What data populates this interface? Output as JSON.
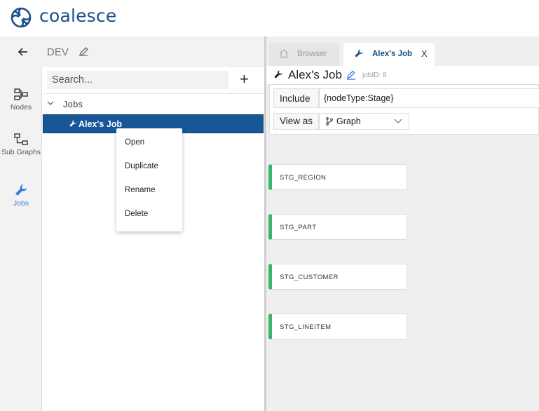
{
  "app": {
    "name": "coalesce",
    "brand_color": "#1a4f8b"
  },
  "subbar": {
    "back_icon": "arrow-left-icon",
    "env": "DEV",
    "edit_icon": "pencil-icon"
  },
  "rail": [
    {
      "label": "Nodes",
      "icon": "nodes-icon"
    },
    {
      "label": "Sub Graphs",
      "icon": "subgraphs-icon"
    },
    {
      "label": "Jobs",
      "icon": "wrench-icon",
      "active": true
    }
  ],
  "tree": {
    "search_placeholder": "Search...",
    "add_label": "+",
    "folder": "Jobs",
    "selected_job": "Alex's Job"
  },
  "context_menu": {
    "items": [
      "Open",
      "Duplicate",
      "Rename",
      "Delete"
    ]
  },
  "tabs": [
    {
      "label": "Browser",
      "icon": "home-icon",
      "active": false
    },
    {
      "label": "Alex's Job",
      "icon": "wrench-icon",
      "active": true,
      "close": "X"
    }
  ],
  "job": {
    "title": "Alex's Job",
    "job_id": "jobID: 8",
    "include_label": "Include",
    "include_value": "{nodeType:Stage}",
    "view_as_label": "View as",
    "view_as_value": "Graph"
  },
  "nodes": [
    "STG_REGION",
    "STG_PART",
    "STG_CUSTOMER",
    "STG_LINEITEM"
  ],
  "colors": {
    "selected_row": "#165896",
    "node_accent": "#3db46d",
    "active_rail": "#3b7bd6"
  }
}
